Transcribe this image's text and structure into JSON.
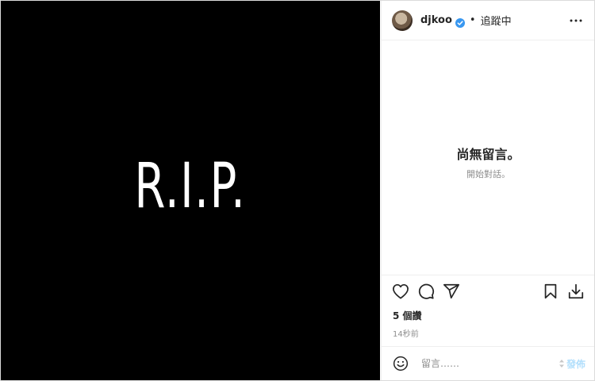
{
  "post": {
    "media_text": "R.I.P."
  },
  "header": {
    "username": "djkoo",
    "separator": "•",
    "follow_label": "追蹤中",
    "verified": true,
    "icons": {
      "verified": "verified-badge-icon",
      "more": "more-options-icon"
    }
  },
  "comments": {
    "empty_title": "尚無留言。",
    "empty_subtitle": "開始對話。"
  },
  "actions": {
    "icons": [
      "heart-icon",
      "comment-icon",
      "share-icon",
      "bookmark-icon",
      "download-icon"
    ]
  },
  "stats": {
    "likes": "5 個讚",
    "time": "14秒前"
  },
  "comment_box": {
    "placeholder": "留言……",
    "post_label": "發佈",
    "icons": {
      "emoji": "emoji-icon"
    }
  },
  "colors": {
    "media_bg": "#000000",
    "text": "#262626",
    "muted": "#8e8e8e",
    "verified": "#3897f0",
    "post_disabled": "#b2dffc",
    "border": "#dbdbdb"
  }
}
